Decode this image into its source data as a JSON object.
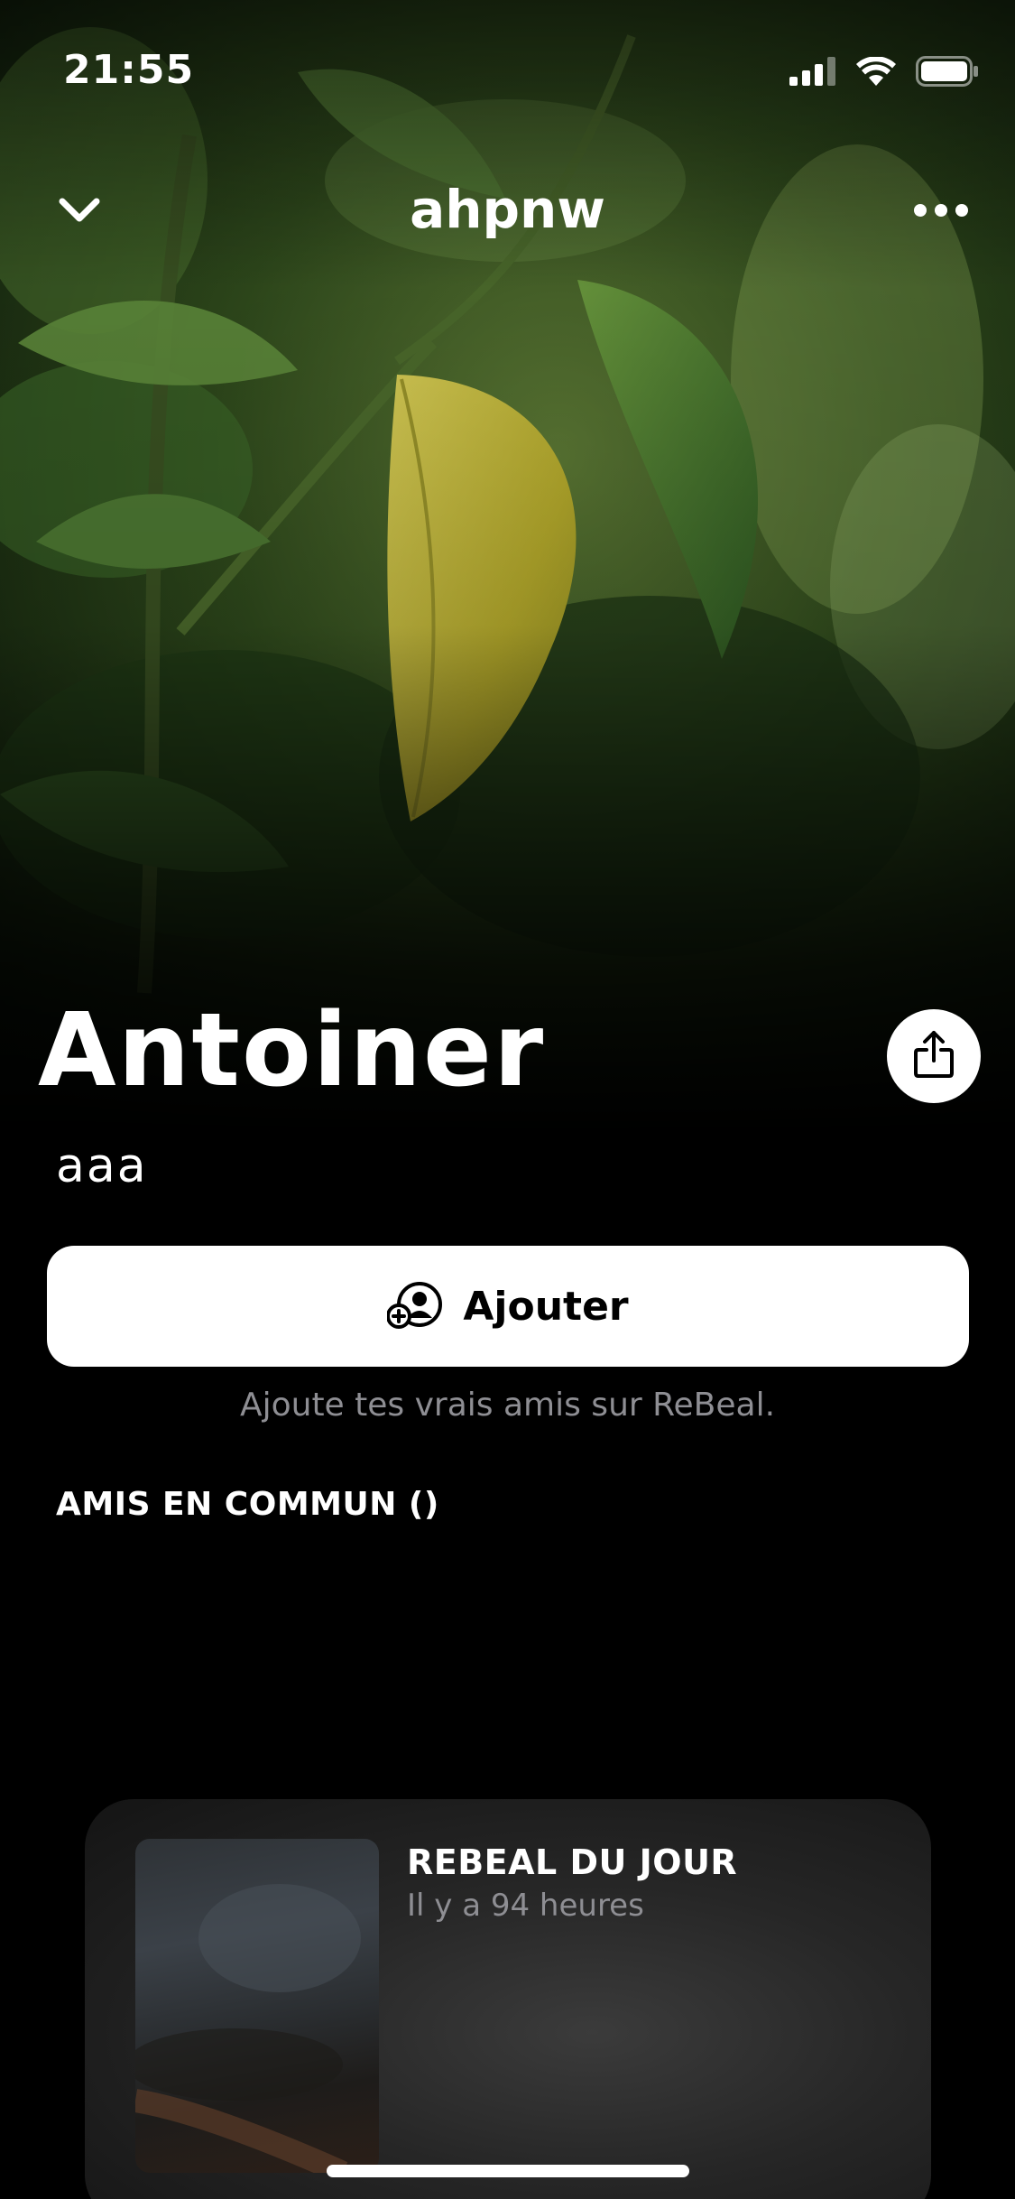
{
  "status_bar": {
    "time": "21:55",
    "icons": [
      "cellular-signal-icon",
      "wifi-icon",
      "battery-icon"
    ]
  },
  "nav": {
    "back_icon": "chevron-down-icon",
    "username": "ahpnw",
    "more_icon": "ellipsis-icon"
  },
  "profile": {
    "name": "Antoiner",
    "bio": "aaa",
    "share_icon": "share-icon"
  },
  "add_button": {
    "label": "Ajouter",
    "icon": "add-friend-icon",
    "hint": "Ajoute tes vrais amis sur ReBeal."
  },
  "mutual_friends": {
    "heading": "AMIS EN COMMUN ()"
  },
  "rebeal_card": {
    "title": "REBEAL DU JOUR",
    "time_ago": "Il y a 94 heures"
  },
  "colors": {
    "background": "#000000",
    "primary_text": "#ffffff",
    "secondary_text": "#8e8e93",
    "button_bg": "#ffffff"
  }
}
